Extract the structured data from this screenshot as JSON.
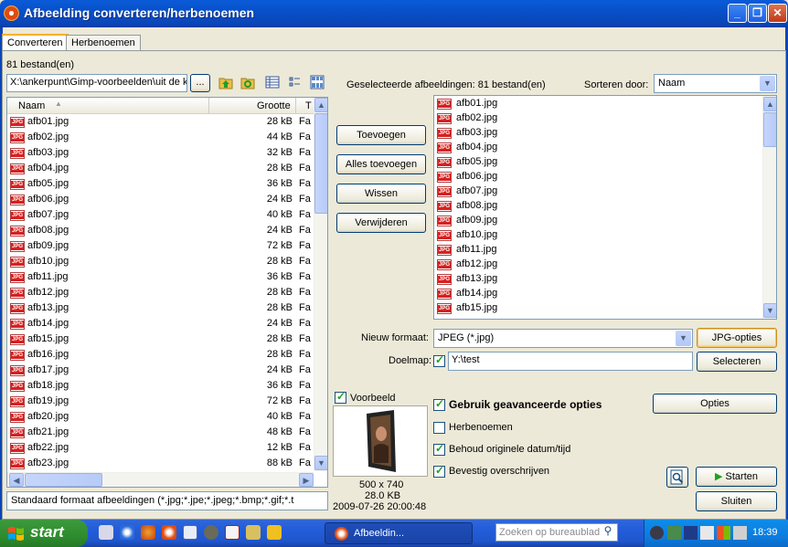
{
  "window": {
    "title": "Afbeelding converteren/herbenoemen",
    "min": "_",
    "max": "❐",
    "close": "✕"
  },
  "tabs": [
    {
      "label": "Converteren"
    },
    {
      "label": "Herbenoemen"
    }
  ],
  "left": {
    "count": "81 bestand(en)",
    "path": "X:\\ankerpunt\\Gimp-voorbeelden\\uit de k",
    "browse": "...",
    "columns": {
      "name": "Naam",
      "size": "Grootte",
      "type": "T"
    },
    "files": [
      {
        "n": "afb01.jpg",
        "s": "28 kB",
        "t": "Fa"
      },
      {
        "n": "afb02.jpg",
        "s": "44 kB",
        "t": "Fa"
      },
      {
        "n": "afb03.jpg",
        "s": "32 kB",
        "t": "Fa"
      },
      {
        "n": "afb04.jpg",
        "s": "28 kB",
        "t": "Fa"
      },
      {
        "n": "afb05.jpg",
        "s": "36 kB",
        "t": "Fa"
      },
      {
        "n": "afb06.jpg",
        "s": "24 kB",
        "t": "Fa"
      },
      {
        "n": "afb07.jpg",
        "s": "40 kB",
        "t": "Fa"
      },
      {
        "n": "afb08.jpg",
        "s": "24 kB",
        "t": "Fa"
      },
      {
        "n": "afb09.jpg",
        "s": "72 kB",
        "t": "Fa"
      },
      {
        "n": "afb10.jpg",
        "s": "28 kB",
        "t": "Fa"
      },
      {
        "n": "afb11.jpg",
        "s": "36 kB",
        "t": "Fa"
      },
      {
        "n": "afb12.jpg",
        "s": "28 kB",
        "t": "Fa"
      },
      {
        "n": "afb13.jpg",
        "s": "28 kB",
        "t": "Fa"
      },
      {
        "n": "afb14.jpg",
        "s": "24 kB",
        "t": "Fa"
      },
      {
        "n": "afb15.jpg",
        "s": "28 kB",
        "t": "Fa"
      },
      {
        "n": "afb16.jpg",
        "s": "28 kB",
        "t": "Fa"
      },
      {
        "n": "afb17.jpg",
        "s": "24 kB",
        "t": "Fa"
      },
      {
        "n": "afb18.jpg",
        "s": "36 kB",
        "t": "Fa"
      },
      {
        "n": "afb19.jpg",
        "s": "72 kB",
        "t": "Fa"
      },
      {
        "n": "afb20.jpg",
        "s": "40 kB",
        "t": "Fa"
      },
      {
        "n": "afb21.jpg",
        "s": "48 kB",
        "t": "Fa"
      },
      {
        "n": "afb22.jpg",
        "s": "12 kB",
        "t": "Fa"
      },
      {
        "n": "afb23.jpg",
        "s": "88 kB",
        "t": "Fa"
      }
    ],
    "filter": "Standaard formaat afbeeldingen (*.jpg;*.jpe;*.jpeg;*.bmp;*.gif;*.t"
  },
  "buttons": {
    "add": "Toevoegen",
    "addall": "Alles toevoegen",
    "clear": "Wissen",
    "remove": "Verwijderen"
  },
  "right": {
    "selected": "Geselecteerde afbeeldingen: 81 bestand(en)",
    "sortby": "Sorteren door:",
    "sortval": "Naam",
    "files": [
      "afb01.jpg",
      "afb02.jpg",
      "afb03.jpg",
      "afb04.jpg",
      "afb05.jpg",
      "afb06.jpg",
      "afb07.jpg",
      "afb08.jpg",
      "afb09.jpg",
      "afb10.jpg",
      "afb11.jpg",
      "afb12.jpg",
      "afb13.jpg",
      "afb14.jpg",
      "afb15.jpg"
    ]
  },
  "format": {
    "label": "Nieuw formaat:",
    "value": "JPEG (*.jpg)",
    "options": "JPG-opties"
  },
  "dest": {
    "label": "Doelmap:",
    "value": "Y:\\test",
    "select": "Selecteren"
  },
  "preview": {
    "label": "Voorbeeld",
    "dims": "500 x 740",
    "size": "28.0 KB",
    "date": "2009-07-26 20:00:48"
  },
  "opts": {
    "advanced": "Gebruik geavanceerde opties",
    "rename": "Herbenoemen",
    "keepdate": "Behoud originele datum/tijd",
    "confirm": "Bevestig overschrijven",
    "optbtn": "Opties"
  },
  "actions": {
    "start": "Starten",
    "close": "Sluiten"
  },
  "taskbar": {
    "start": "start",
    "task": "Afbeeldin...",
    "search": "Zoeken op bureaublad",
    "time": "18:39"
  }
}
